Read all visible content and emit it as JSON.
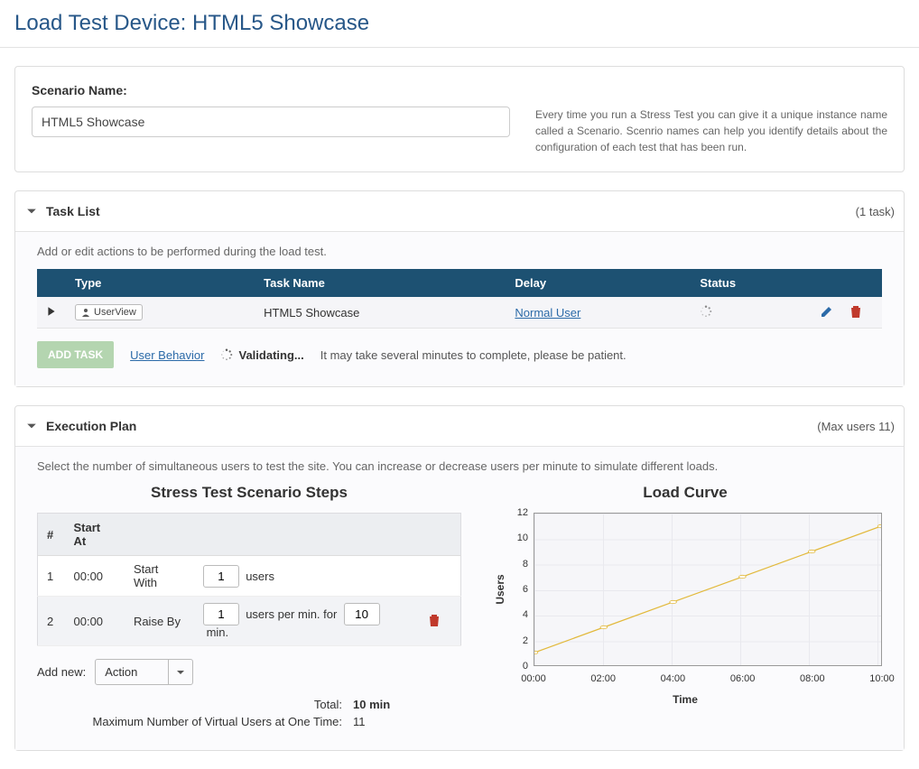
{
  "pageTitle": "Load Test Device: HTML5 Showcase",
  "scenario": {
    "label": "Scenario Name:",
    "value": "HTML5 Showcase",
    "help": "Every time you run a Stress Test you can give it a unique instance name called a Scenario. Scenrio names can help you identify details about the configuration of each test that has been run."
  },
  "taskList": {
    "title": "Task List",
    "count": "(1 task)",
    "desc": "Add or edit actions to be performed during the load test.",
    "headers": {
      "type": "Type",
      "name": "Task Name",
      "delay": "Delay",
      "status": "Status"
    },
    "rows": [
      {
        "typeBadge": "UserView",
        "name": "HTML5 Showcase",
        "delay": "Normal User",
        "status": "loading"
      }
    ],
    "addTaskBtn": "ADD TASK",
    "userBehavior": "User Behavior",
    "validating": "Validating...",
    "validatingNote": "It may take several minutes to complete, please be patient."
  },
  "execPlan": {
    "title": "Execution Plan",
    "extra": "(Max users 11)",
    "desc": "Select the number of simultaneous users to test the site. You can increase or decrease users per minute to simulate different loads.",
    "stepsTitle": "Stress Test Scenario Steps",
    "stepsHeaders": {
      "num": "#",
      "start": "Start At"
    },
    "steps": [
      {
        "num": "1",
        "start": "00:00",
        "action": "Start With",
        "v1": "1",
        "suffix1": "users"
      },
      {
        "num": "2",
        "start": "00:00",
        "action": "Raise By",
        "v1": "1",
        "suffix1": "users per min. for",
        "v2": "10",
        "suffix2": "min."
      }
    ],
    "addNewLabel": "Add new:",
    "addNewValue": "Action",
    "totals": {
      "totalLabel": "Total:",
      "totalValue": "10 min",
      "maxLabel": "Maximum Number of Virtual Users at One Time:",
      "maxValue": "11"
    },
    "chartTitle": "Load Curve",
    "yLabel": "Users",
    "xLabel": "Time"
  },
  "chart_data": {
    "type": "line",
    "title": "Load Curve",
    "xlabel": "Time",
    "ylabel": "Users",
    "ylim": [
      0,
      12
    ],
    "x_categories": [
      "00:00",
      "02:00",
      "04:00",
      "06:00",
      "08:00",
      "10:00"
    ],
    "y_ticks": [
      0,
      2,
      4,
      6,
      8,
      10,
      12
    ],
    "series": [
      {
        "name": "Users",
        "x": [
          "00:00",
          "02:00",
          "04:00",
          "06:00",
          "08:00",
          "10:00"
        ],
        "values": [
          1,
          3,
          5,
          7,
          9,
          11
        ]
      }
    ]
  }
}
